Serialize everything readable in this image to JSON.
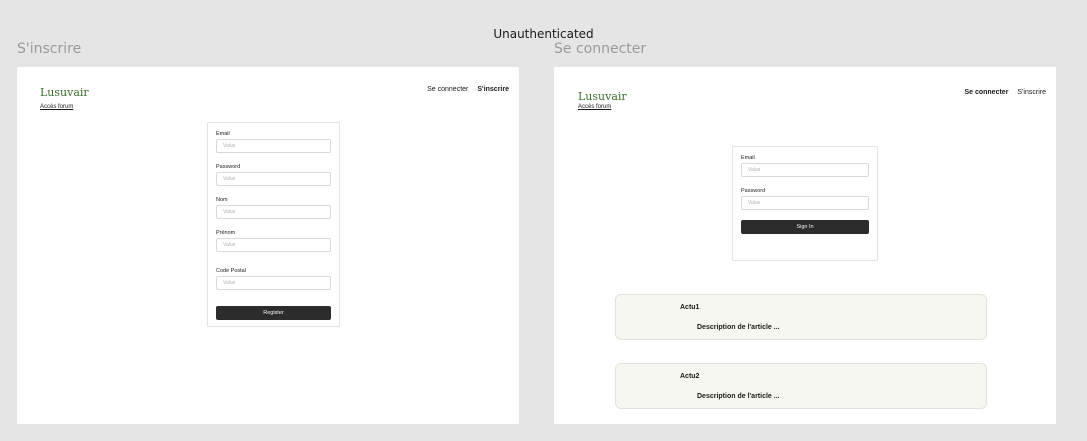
{
  "canvas_title": "Unauthenticated",
  "frames": {
    "register": {
      "label": "S'inscrire",
      "logo": "Lusuvair",
      "forum_link": "Accès forum",
      "nav": {
        "login": "Se connecter",
        "register": "S'inscrire"
      },
      "fields": [
        {
          "label": "Email",
          "placeholder": "Value"
        },
        {
          "label": "Password",
          "placeholder": "Value"
        },
        {
          "label": "Nom",
          "placeholder": "Value"
        },
        {
          "label": "Prénom",
          "placeholder": "Value"
        },
        {
          "label": "Code Postal",
          "placeholder": "Value"
        }
      ],
      "submit": "Register"
    },
    "login": {
      "label": "Se connecter",
      "logo": "Lusuvair",
      "forum_link": "Accès forum",
      "nav": {
        "login": "Se connecter",
        "register": "S'inscrire"
      },
      "fields": [
        {
          "label": "Email",
          "placeholder": "Value"
        },
        {
          "label": "Password",
          "placeholder": "Value"
        }
      ],
      "submit": "Sign In",
      "news": [
        {
          "title": "Actu1",
          "description": "Description de l'article ..."
        },
        {
          "title": "Actu2",
          "description": "Description de l'article ..."
        }
      ]
    }
  },
  "colors": {
    "canvas": "#e5e5e5",
    "brand_green": "#3c6e2c",
    "button_dark": "#2c2c2c",
    "news_bg": "#f7f7f2"
  }
}
